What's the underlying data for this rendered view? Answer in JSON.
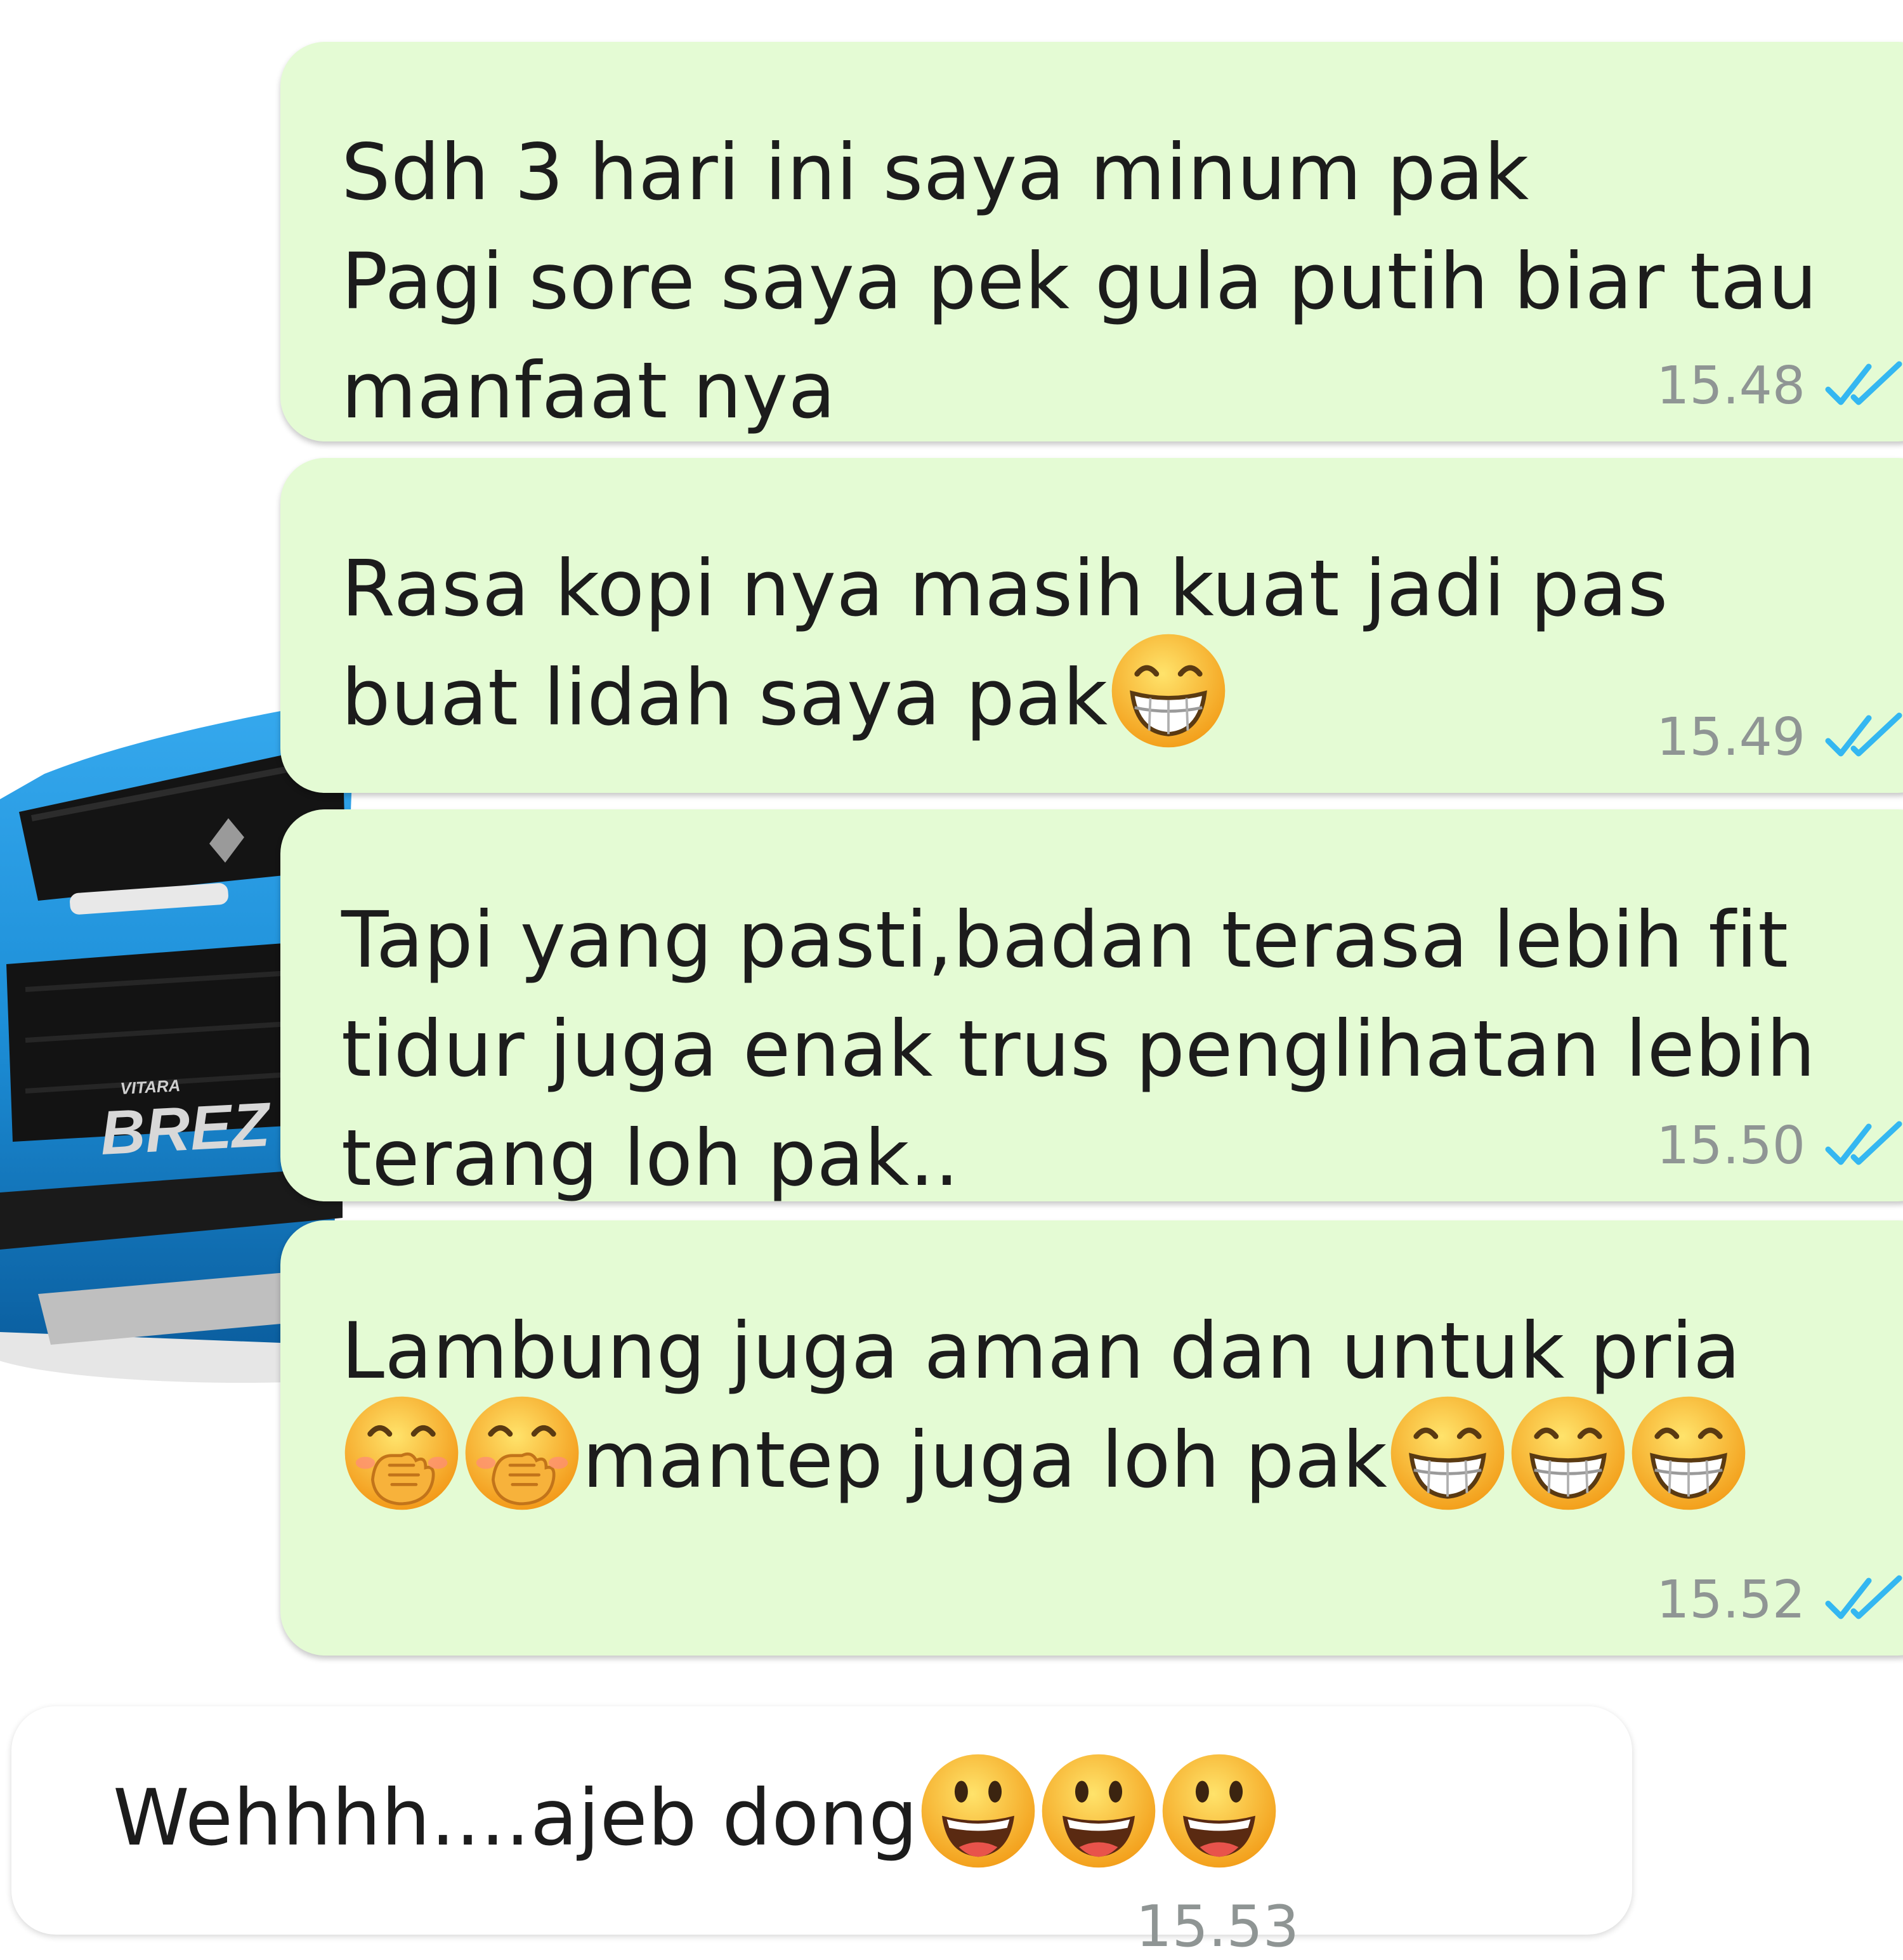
{
  "conversation": {
    "messages": [
      {
        "direction": "outgoing",
        "lines": [
          {
            "parts": [
              {
                "text": "Sdh 3 hari ini saya minum pak"
              }
            ]
          },
          {
            "parts": [
              {
                "text": "Pagi sore saya pek gula putih biar tau"
              }
            ]
          },
          {
            "parts": [
              {
                "text": "manfaat nya"
              }
            ]
          }
        ],
        "time": "15.48",
        "status": "read",
        "status_icon": "double-check-icon"
      },
      {
        "direction": "outgoing",
        "lines": [
          {
            "parts": [
              {
                "text": "Rasa kopi nya masih kuat jadi pas"
              }
            ]
          },
          {
            "parts": [
              {
                "text": "buat lidah saya pak"
              },
              {
                "emoji": "grinning-squinting-face"
              }
            ]
          }
        ],
        "time": "15.49",
        "status": "read",
        "status_icon": "double-check-icon"
      },
      {
        "direction": "outgoing",
        "lines": [
          {
            "parts": [
              {
                "text": "Tapi yang pasti,badan terasa lebih fit"
              }
            ]
          },
          {
            "parts": [
              {
                "text": "tidur juga enak trus penglihatan lebih"
              }
            ]
          },
          {
            "parts": [
              {
                "text": "terang loh pak.."
              }
            ]
          }
        ],
        "time": "15.50",
        "status": "read",
        "status_icon": "double-check-icon"
      },
      {
        "direction": "outgoing",
        "lines": [
          {
            "parts": [
              {
                "text": "Lambung juga aman dan untuk pria"
              }
            ]
          },
          {
            "parts": [
              {
                "emoji": "face-with-hand-over-mouth"
              },
              {
                "emoji": "face-with-hand-over-mouth"
              },
              {
                "text": "mantep juga loh pak"
              },
              {
                "emoji": "grinning-squinting-face"
              },
              {
                "emoji": "grinning-squinting-face"
              },
              {
                "emoji": "grinning-squinting-face"
              }
            ]
          }
        ],
        "time": "15.52",
        "status": "read",
        "status_icon": "double-check-icon"
      },
      {
        "direction": "incoming",
        "lines": [
          {
            "parts": [
              {
                "text": "Wehhhh....ajeb dong"
              },
              {
                "emoji": "grinning-face-big-eyes"
              },
              {
                "emoji": "grinning-face-big-eyes"
              },
              {
                "emoji": "grinning-face-big-eyes"
              }
            ]
          }
        ],
        "time": "15.53"
      }
    ]
  },
  "background": {
    "image": "blue-suv-front",
    "badge_small": "VITARA",
    "badge_large": "BREZ"
  },
  "colors": {
    "outgoing_bubble": "#e4fbd4",
    "incoming_bubble": "#ffffff",
    "timestamp": "#8f9594",
    "read_check": "#34b7f1",
    "car_blue": "#1d8fd8"
  }
}
